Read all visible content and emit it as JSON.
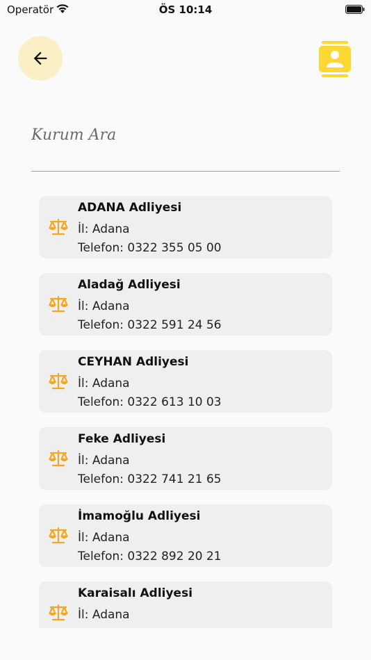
{
  "status_bar": {
    "carrier": "Operatör",
    "time": "ÖS 10:14",
    "icons": [
      "wifi-icon",
      "battery-icon"
    ]
  },
  "header": {
    "back_icon": "arrow-left-icon",
    "contacts_icon": "contact-book-icon"
  },
  "search": {
    "placeholder": "Kurum Ara",
    "value": ""
  },
  "colors": {
    "accent": "#f5a623",
    "contacts_icon": "#fdd835",
    "back_bg": "#fbefc6",
    "card_bg": "#efefef"
  },
  "items": [
    {
      "icon": "scale-icon",
      "name": "ADANA Adliyesi",
      "city": "İl: Adana",
      "phone": "Telefon: 0322 355 05 00"
    },
    {
      "icon": "scale-icon",
      "name": "Aladağ Adliyesi",
      "city": "İl: Adana",
      "phone": "Telefon: 0322 591 24 56"
    },
    {
      "icon": "scale-icon",
      "name": "CEYHAN Adliyesi",
      "city": "İl: Adana",
      "phone": "Telefon: 0322 613 10 03"
    },
    {
      "icon": "scale-icon",
      "name": "Feke Adliyesi",
      "city": "İl: Adana",
      "phone": "Telefon: 0322 741 21 65"
    },
    {
      "icon": "scale-icon",
      "name": "İmamoğlu Adliyesi",
      "city": "İl: Adana",
      "phone": "Telefon: 0322 892 20 21"
    },
    {
      "icon": "scale-icon",
      "name": "Karaisalı Adliyesi",
      "city": "İl: Adana",
      "phone": ""
    }
  ]
}
